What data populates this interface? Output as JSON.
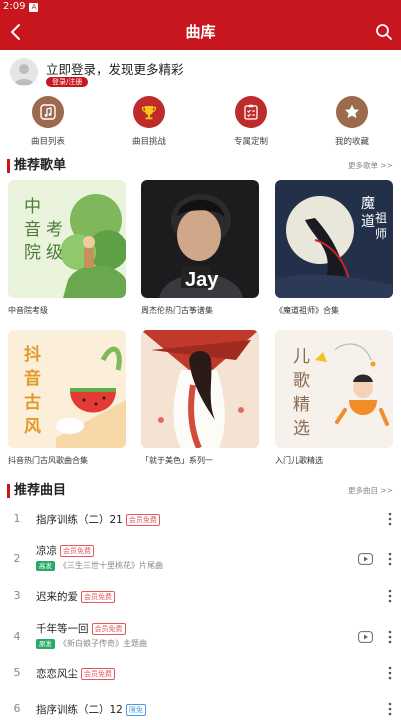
{
  "status": {
    "time": "2:09",
    "badge": "A"
  },
  "header": {
    "title": "曲库"
  },
  "login": {
    "prompt": "立即登录，发现更多精彩",
    "button": "登录/注册"
  },
  "quick_links": [
    {
      "label": "曲目列表",
      "icon": "music-note-icon"
    },
    {
      "label": "曲目挑战",
      "icon": "trophy-icon"
    },
    {
      "label": "专属定制",
      "icon": "checklist-icon"
    },
    {
      "label": "我的收藏",
      "icon": "star-icon"
    }
  ],
  "playlists": {
    "title": "推荐歌单",
    "more": "更多歌单 >>",
    "items": [
      {
        "title": "中音院考级",
        "cover_text": "中音院考级"
      },
      {
        "title": "周杰伦热门古筝谱集",
        "cover_text": "Jay"
      },
      {
        "title": "《魔道祖师》合集",
        "cover_text": "魔道祖师"
      },
      {
        "title": "抖音热门古风歌曲合集",
        "cover_text": "抖音古风"
      },
      {
        "title": "「就于美色」系列一",
        "cover_text": ""
      },
      {
        "title": "入门儿歌精选",
        "cover_text": "儿歌精选"
      }
    ]
  },
  "songs": {
    "title": "推荐曲目",
    "more": "更多曲目 >>",
    "items": [
      {
        "num": "1",
        "name": "指序训练（二）21",
        "tag": "会员免费",
        "sub_tag": "",
        "sub": "",
        "video": false
      },
      {
        "num": "2",
        "name": "凉凉",
        "tag": "会员免费",
        "sub_tag": "高发",
        "sub": "《三生三世十里桃花》片尾曲",
        "video": true
      },
      {
        "num": "3",
        "name": "迟来的爱",
        "tag": "会员免费",
        "sub_tag": "",
        "sub": "",
        "video": false
      },
      {
        "num": "4",
        "name": "千年等一回",
        "tag": "会员免费",
        "sub_tag": "原发",
        "sub": "《新白娘子传奇》主题曲",
        "video": true
      },
      {
        "num": "5",
        "name": "恋恋风尘",
        "tag": "会员免费",
        "sub_tag": "",
        "sub": "",
        "video": false
      },
      {
        "num": "6",
        "name": "指序训练（二）12",
        "tag": "限免",
        "sub_tag": "",
        "sub": "",
        "video": false
      }
    ]
  },
  "colors": {
    "brand": "#c8161e",
    "tag": "#e2585f",
    "green": "#2aa866"
  }
}
